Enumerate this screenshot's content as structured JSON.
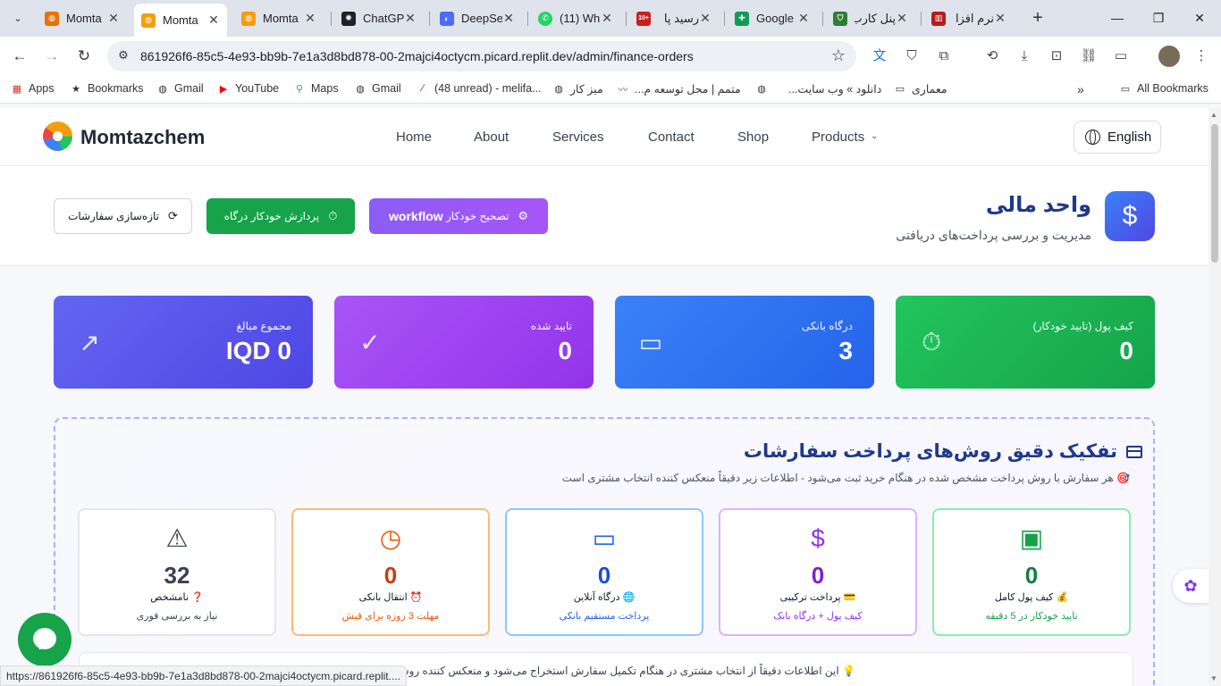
{
  "browser": {
    "tabs": [
      {
        "title": "Momta",
        "favicon_color": "#e8710a"
      },
      {
        "title": "Momta",
        "favicon_color": "#f59e0b",
        "active": true
      },
      {
        "title": "Momta",
        "favicon_color": "#f59e0b"
      },
      {
        "title": "ChatGP",
        "favicon_color": "#202123"
      },
      {
        "title": "DeepSe",
        "favicon_color": "#4d6bfe"
      },
      {
        "title": "(11) Wh",
        "favicon_color": "#25d366"
      },
      {
        "title": "رسید پا",
        "favicon_color": "#c5221f",
        "favicon_text": "10+"
      },
      {
        "title": "Google",
        "favicon_color": "#0f9d58"
      },
      {
        "title": "پنل کارب",
        "favicon_color": "#2e7d32"
      },
      {
        "title": "نرم افزا",
        "favicon_color": "#b71c1c"
      }
    ],
    "url": "861926f6-85c5-4e93-bb9b-7e1a3d8bd878-00-2majci4octycm.picard.replit.dev/admin/finance-orders",
    "bookmarks": [
      {
        "label": "Apps",
        "icon": "apps-grid-icon"
      },
      {
        "label": "Bookmarks",
        "icon": "star-icon"
      },
      {
        "label": "Gmail",
        "icon": "globe-icon"
      },
      {
        "label": "YouTube",
        "icon": "youtube-icon"
      },
      {
        "label": "Maps",
        "icon": "maps-pin-icon"
      },
      {
        "label": "Gmail",
        "icon": "globe-icon"
      },
      {
        "label": "(48 unread) - melifa...",
        "icon": "yahoo-icon"
      },
      {
        "label": "میز کار",
        "icon": "globe-icon"
      },
      {
        "label": "متمم | محل توسعه م...",
        "icon": "leaf-icon"
      },
      {
        "label": "",
        "icon": "globe-icon"
      },
      {
        "label": "دانلود » وب سایت...",
        "icon": "none"
      },
      {
        "label": "معماری",
        "icon": "folder-icon"
      }
    ],
    "all_bookmarks": "All Bookmarks",
    "status_url": "https://861926f6-85c5-4e93-bb9b-7e1a3d8bd878-00-2majci4octycm.picard.replit...."
  },
  "site": {
    "brand": "Momtazchem",
    "nav": [
      "Home",
      "About",
      "Services",
      "Contact",
      "Shop",
      "Products"
    ],
    "language": "English"
  },
  "finance": {
    "title": "واحد مالی",
    "subtitle": "مدیریت و بررسی پرداخت‌های دریافتی",
    "icon_symbol": "$",
    "buttons": {
      "workflow_prefix": "تصحیح خودکار",
      "workflow_strong": "workflow",
      "gateway": "پردازش خودکار درگاه",
      "refresh": "تازه‌سازی سفارشات"
    }
  },
  "stats": [
    {
      "label": "کیف پول (تایید خودکار)",
      "value": "0",
      "icon": "stopwatch-icon",
      "color": "#16a34a"
    },
    {
      "label": "درگاه بانکی",
      "value": "3",
      "icon": "credit-card-icon",
      "color": "#2563eb"
    },
    {
      "label": "تایید شده",
      "value": "0",
      "icon": "check-circle-icon",
      "color": "#9333ea"
    },
    {
      "label": "مجموع مبالغ",
      "value": "IQD 0",
      "icon": "trending-up-icon",
      "color": "#4f46e5"
    }
  ],
  "breakdown": {
    "title": "تفکیک دقیق روش‌های پرداخت سفارشات",
    "description": "🎯 هر سفارش با روش پرداخت مشخص شده در هنگام خرید ثبت می‌شود - اطلاعات زیر دقیقاً منعکس کننده انتخاب مشتری است",
    "methods": [
      {
        "value": "0",
        "label": "💰 کیف پول کامل",
        "note": "تایید خودکار در 5 دقیقه",
        "icon": "wallet-icon",
        "color": "#16a34a"
      },
      {
        "value": "0",
        "label": "💳 پرداخت ترکیبی",
        "note": "کیف پول + درگاه بانک",
        "icon": "dollar-icon",
        "color": "#9333ea"
      },
      {
        "value": "0",
        "label": "🌐 درگاه آنلاین",
        "note": "پرداخت مستقیم بانکی",
        "icon": "credit-card-icon",
        "color": "#2563eb"
      },
      {
        "value": "0",
        "label": "⏰ انتقال بانکی",
        "note": "مهلت 3 روزه برای فیش",
        "icon": "clock-icon",
        "color": "#ea580c"
      },
      {
        "value": "32",
        "label": "❓ نامشخص",
        "note": "نیاز به بررسی فوری",
        "icon": "warning-triangle-icon",
        "color": "#374151"
      }
    ],
    "info": "💡 این اطلاعات دقیقاً از انتخاب مشتری در هنگام تکمیل سفارش استخراج می‌شود و منعکس کننده روش پرداخت"
  }
}
